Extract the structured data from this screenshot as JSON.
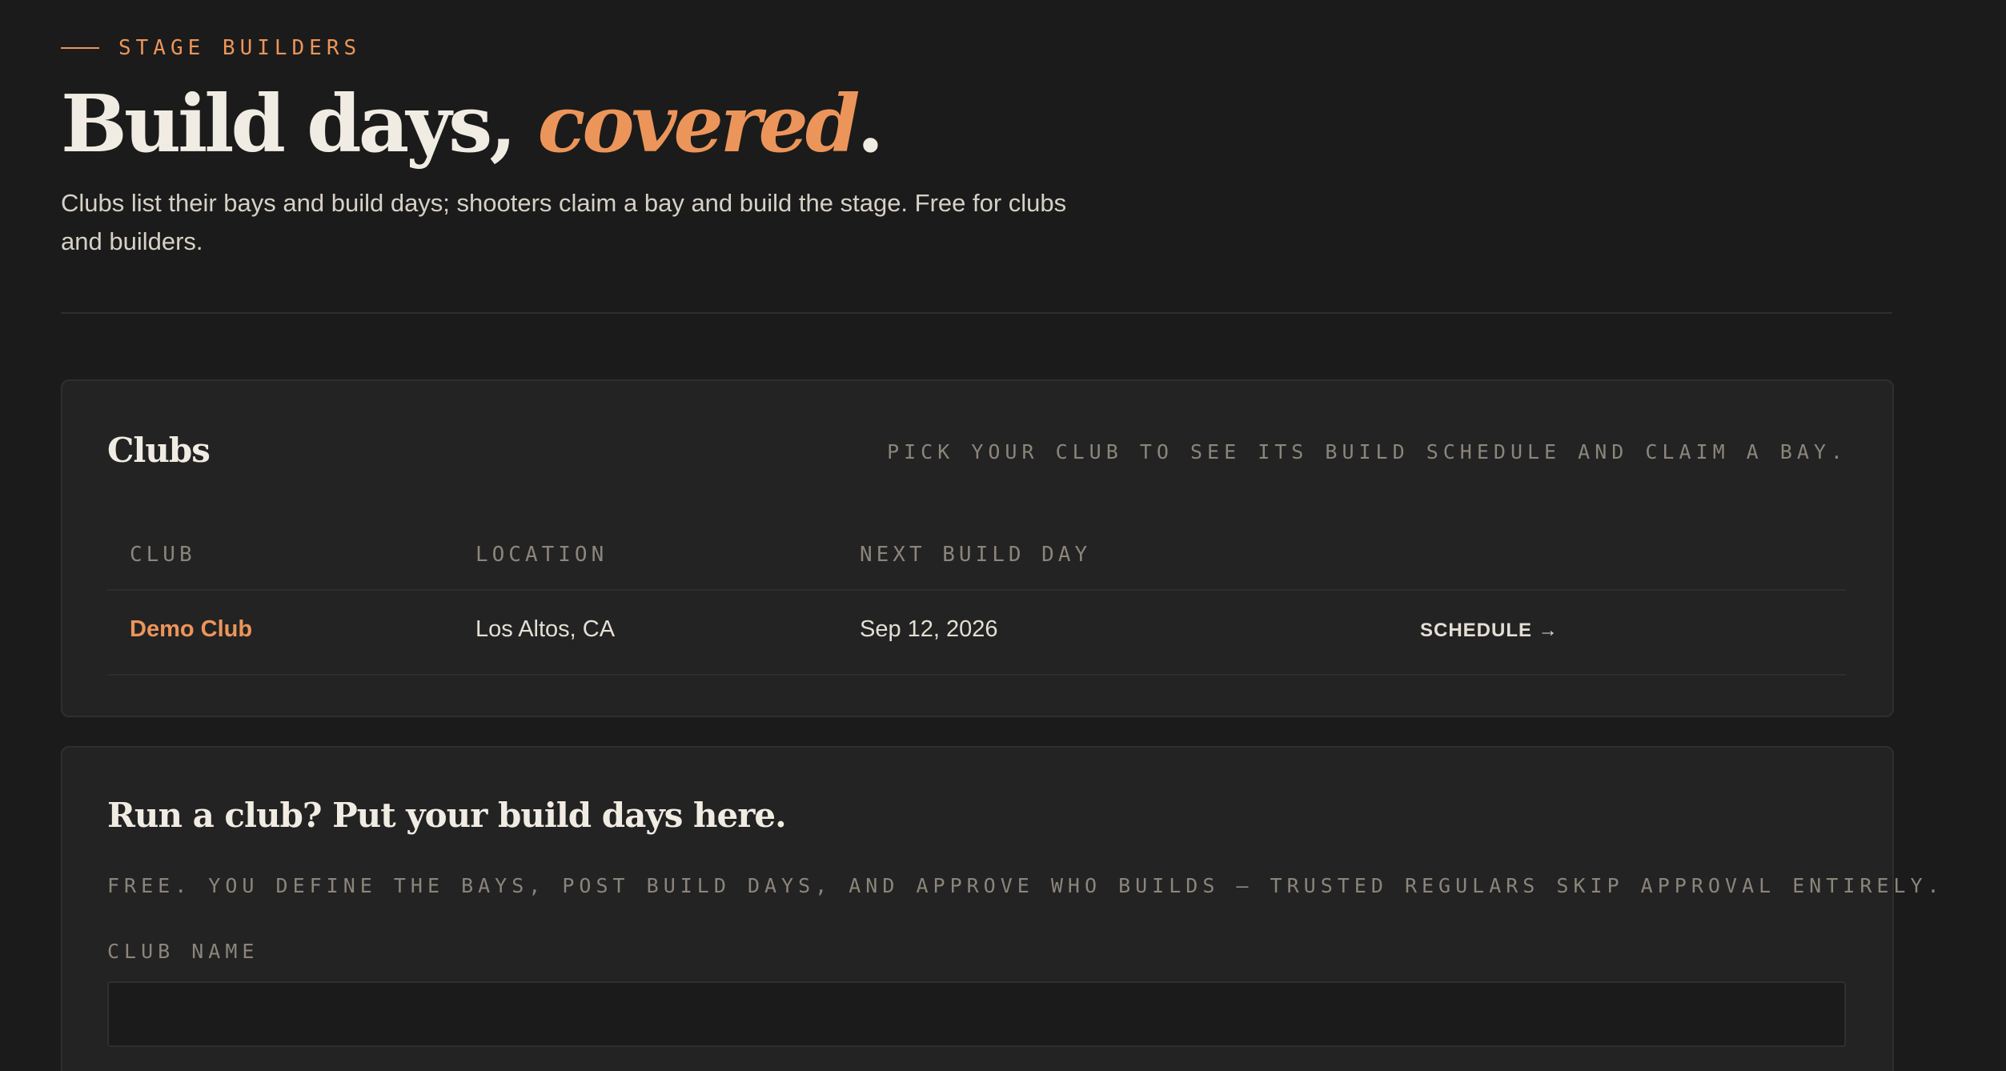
{
  "colors": {
    "background": "#1b1b1b",
    "card": "#232323",
    "accent": "#ec955a",
    "text": "#f1ece3",
    "muted": "#8b857b"
  },
  "header": {
    "eyebrow": "STAGE BUILDERS",
    "title_main": "Build days, ",
    "title_accent": "covered",
    "title_end": ".",
    "subtitle": "Clubs list their bays and build days; shooters claim a bay and build the stage. Free for clubs and builders."
  },
  "clubs_section": {
    "title": "Clubs",
    "hint": "PICK YOUR CLUB TO SEE ITS BUILD SCHEDULE AND CLAIM A BAY.",
    "columns": [
      "CLUB",
      "LOCATION",
      "NEXT BUILD DAY"
    ],
    "rows": [
      {
        "club": "Demo Club",
        "location": "Los Altos, CA",
        "next_build_day": "Sep 12, 2026",
        "action": "SCHEDULE →"
      }
    ]
  },
  "run_club_section": {
    "title": "Run a club? Put your build days here.",
    "hint": "FREE. YOU DEFINE THE BAYS, POST BUILD DAYS, AND APPROVE WHO BUILDS — TRUSTED REGULARS SKIP APPROVAL ENTIRELY.",
    "club_name_label": "CLUB NAME",
    "club_name_value": ""
  }
}
